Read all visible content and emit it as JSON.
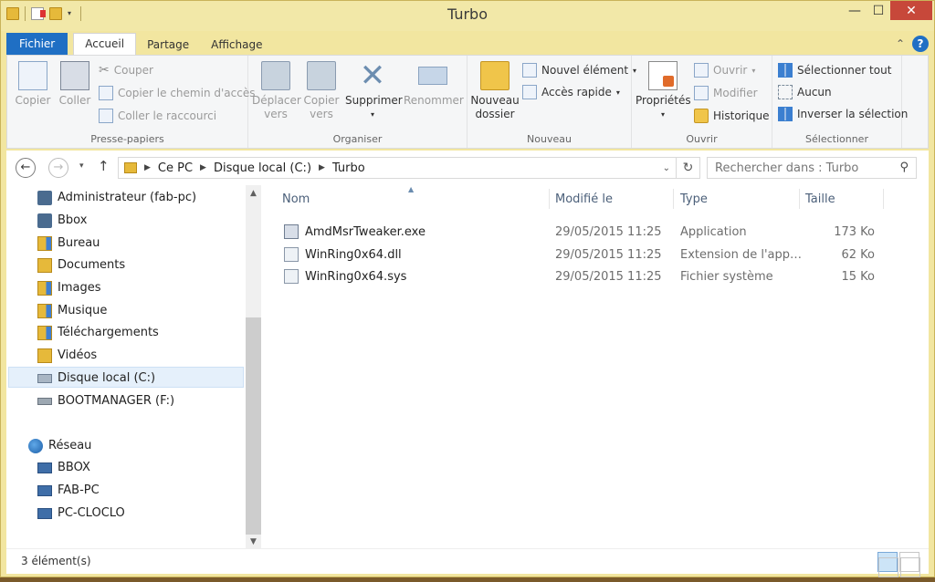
{
  "window": {
    "title": "Turbo"
  },
  "ribbon_tabs": [
    "Fichier",
    "Accueil",
    "Partage",
    "Affichage"
  ],
  "clipboard": {
    "copy": "Copier",
    "paste": "Coller",
    "cut": "Couper",
    "copy_path": "Copier le chemin d'accès",
    "paste_shortcut": "Coller le raccourci",
    "label": "Presse-papiers"
  },
  "organize": {
    "move_to_1": "Déplacer",
    "move_to_2": "vers",
    "copy_to_1": "Copier",
    "copy_to_2": "vers",
    "delete": "Supprimer",
    "rename": "Renommer",
    "label": "Organiser"
  },
  "new": {
    "new_folder_1": "Nouveau",
    "new_folder_2": "dossier",
    "new_item": "Nouvel élément",
    "easy_access": "Accès rapide",
    "label": "Nouveau"
  },
  "open": {
    "properties": "Propriétés",
    "open": "Ouvrir",
    "edit": "Modifier",
    "history": "Historique",
    "label": "Ouvrir"
  },
  "select": {
    "select_all": "Sélectionner tout",
    "select_none": "Aucun",
    "invert": "Inverser la sélection",
    "label": "Sélectionner"
  },
  "address": {
    "crumbs": [
      "Ce PC",
      "Disque local (C:)",
      "Turbo"
    ],
    "search_placeholder": "Rechercher dans : Turbo"
  },
  "nav": [
    {
      "label": "Administrateur (fab-pc)",
      "icon": "user-folder-icon"
    },
    {
      "label": "Bbox",
      "icon": "user-folder-icon"
    },
    {
      "label": "Bureau",
      "icon": "desktop-folder-icon"
    },
    {
      "label": "Documents",
      "icon": "documents-folder-icon"
    },
    {
      "label": "Images",
      "icon": "pictures-folder-icon"
    },
    {
      "label": "Musique",
      "icon": "music-folder-icon"
    },
    {
      "label": "Téléchargements",
      "icon": "downloads-folder-icon"
    },
    {
      "label": "Vidéos",
      "icon": "videos-folder-icon"
    },
    {
      "label": "Disque local (C:)",
      "icon": "local-drive-icon"
    },
    {
      "label": "BOOTMANAGER (F:)",
      "icon": "usb-drive-icon"
    },
    {
      "label": "Réseau",
      "icon": "network-icon"
    },
    {
      "label": "BBOX",
      "icon": "computer-icon"
    },
    {
      "label": "FAB-PC",
      "icon": "computer-icon"
    },
    {
      "label": "PC-CLOCLO",
      "icon": "computer-icon"
    }
  ],
  "columns": [
    "Nom",
    "Modifié le",
    "Type",
    "Taille"
  ],
  "files": [
    {
      "name": "AmdMsrTweaker.exe",
      "modified": "29/05/2015 11:25",
      "type": "Application",
      "size": "173 Ko"
    },
    {
      "name": "WinRing0x64.dll",
      "modified": "29/05/2015 11:25",
      "type": "Extension de l'app…",
      "size": "62 Ko"
    },
    {
      "name": "WinRing0x64.sys",
      "modified": "29/05/2015 11:25",
      "type": "Fichier système",
      "size": "15 Ko"
    }
  ],
  "status": {
    "count": "3 élément(s)"
  }
}
